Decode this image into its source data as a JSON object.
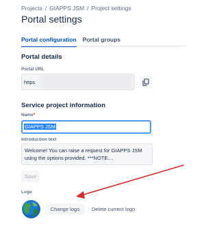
{
  "breadcrumb": {
    "items": [
      "Projects",
      "GIAPPS JSM",
      "Project settings"
    ],
    "separator": "/"
  },
  "page": {
    "title": "Portal settings"
  },
  "tabs": [
    {
      "label": "Portal configuration",
      "active": true
    },
    {
      "label": "Portal groups",
      "active": false
    }
  ],
  "portal_details": {
    "heading": "Portal details",
    "url_label": "Portal URL",
    "url_value": "https",
    "copy_icon": "copy-icon"
  },
  "service_info": {
    "heading": "Service project information",
    "name_label": "Name",
    "name_required": "*",
    "name_value": "GIAPPS JSM",
    "intro_label": "Introduction text",
    "intro_value": "Welcome! You can raise a request for GIAPPS JSM using the options provided.  ***NOTE....",
    "save_label": "Save"
  },
  "logo": {
    "label": "Logo",
    "avatar_icon": "globe-icon",
    "change_label": "Change logo",
    "delete_label": "Delete current logo"
  },
  "annotation": {
    "color": "#d62c2c"
  }
}
